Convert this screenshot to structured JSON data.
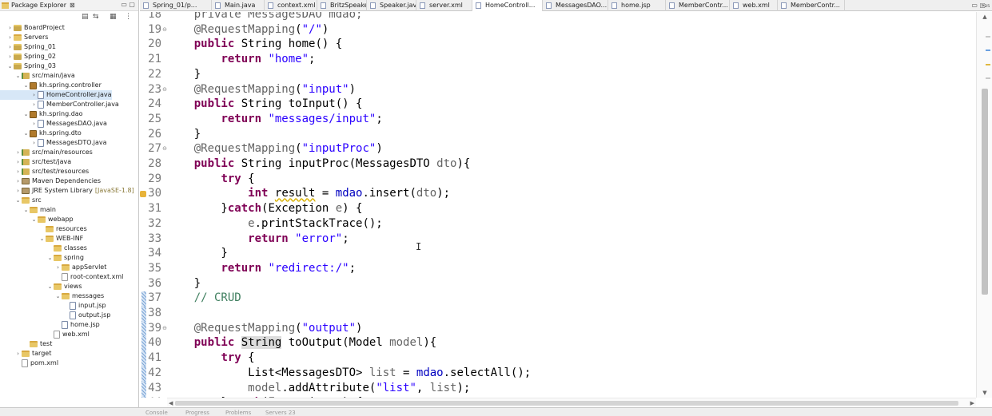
{
  "explorer": {
    "title": "Package Explorer",
    "close": "⊠",
    "winbtns": "▭  ▢",
    "tree": [
      {
        "label": "BoardProject",
        "indent": 0,
        "tw": "›",
        "icon": "proj"
      },
      {
        "label": "Servers",
        "indent": 0,
        "tw": "›",
        "icon": "folder"
      },
      {
        "label": "Spring_01",
        "indent": 0,
        "tw": "›",
        "icon": "proj"
      },
      {
        "label": "Spring_02",
        "indent": 0,
        "tw": "›",
        "icon": "proj"
      },
      {
        "label": "Spring_03",
        "indent": 0,
        "tw": "⌄",
        "icon": "proj"
      },
      {
        "label": "src/main/java",
        "indent": 1,
        "tw": "⌄",
        "icon": "srcf"
      },
      {
        "label": "kh.spring.controller",
        "indent": 2,
        "tw": "⌄",
        "icon": "pkg"
      },
      {
        "label": "HomeController.java",
        "indent": 3,
        "tw": "›",
        "icon": "java",
        "selected": true
      },
      {
        "label": "MemberController.java",
        "indent": 3,
        "tw": "›",
        "icon": "java"
      },
      {
        "label": "kh.spring.dao",
        "indent": 2,
        "tw": "⌄",
        "icon": "pkg"
      },
      {
        "label": "MessagesDAO.java",
        "indent": 3,
        "tw": "›",
        "icon": "java"
      },
      {
        "label": "kh.spring.dto",
        "indent": 2,
        "tw": "⌄",
        "icon": "pkg"
      },
      {
        "label": "MessagesDTO.java",
        "indent": 3,
        "tw": "›",
        "icon": "java"
      },
      {
        "label": "src/main/resources",
        "indent": 1,
        "tw": "›",
        "icon": "srcf"
      },
      {
        "label": "src/test/java",
        "indent": 1,
        "tw": "›",
        "icon": "srcf"
      },
      {
        "label": "src/test/resources",
        "indent": 1,
        "tw": "›",
        "icon": "srcf"
      },
      {
        "label": "Maven Dependencies",
        "indent": 1,
        "tw": "›",
        "icon": "lib"
      },
      {
        "label": "JRE System Library",
        "indent": 1,
        "tw": "›",
        "icon": "lib",
        "deco": "[JavaSE-1.8]"
      },
      {
        "label": "src",
        "indent": 1,
        "tw": "⌄",
        "icon": "folder"
      },
      {
        "label": "main",
        "indent": 2,
        "tw": "⌄",
        "icon": "folder"
      },
      {
        "label": "webapp",
        "indent": 3,
        "tw": "⌄",
        "icon": "folder"
      },
      {
        "label": "resources",
        "indent": 4,
        "tw": "",
        "icon": "folder"
      },
      {
        "label": "WEB-INF",
        "indent": 4,
        "tw": "⌄",
        "icon": "folder"
      },
      {
        "label": "classes",
        "indent": 5,
        "tw": "",
        "icon": "folder"
      },
      {
        "label": "spring",
        "indent": 5,
        "tw": "⌄",
        "icon": "folder"
      },
      {
        "label": "appServlet",
        "indent": 6,
        "tw": "›",
        "icon": "folder"
      },
      {
        "label": "root-context.xml",
        "indent": 6,
        "tw": "",
        "icon": "xml"
      },
      {
        "label": "views",
        "indent": 5,
        "tw": "⌄",
        "icon": "folder"
      },
      {
        "label": "messages",
        "indent": 6,
        "tw": "⌄",
        "icon": "folder"
      },
      {
        "label": "input.jsp",
        "indent": 7,
        "tw": "",
        "icon": "jsp"
      },
      {
        "label": "output.jsp",
        "indent": 7,
        "tw": "",
        "icon": "jsp"
      },
      {
        "label": "home.jsp",
        "indent": 6,
        "tw": "",
        "icon": "jsp"
      },
      {
        "label": "web.xml",
        "indent": 5,
        "tw": "",
        "icon": "xml"
      },
      {
        "label": "test",
        "indent": 2,
        "tw": "",
        "icon": "folder"
      },
      {
        "label": "target",
        "indent": 1,
        "tw": "›",
        "icon": "folder"
      },
      {
        "label": "pom.xml",
        "indent": 1,
        "tw": "",
        "icon": "xml"
      }
    ]
  },
  "tabs": [
    {
      "label": "Spring_01/p...",
      "width": 90
    },
    {
      "label": "Main.java",
      "width": 66
    },
    {
      "label": "context.xml",
      "width": 66
    },
    {
      "label": "BritzSpeake...",
      "width": 62
    },
    {
      "label": "Speaker.java",
      "width": 62
    },
    {
      "label": "server.xml",
      "width": 70
    },
    {
      "label": "HomeControll...",
      "width": 88,
      "active": true
    },
    {
      "label": "MessagesDAO...",
      "width": 82
    },
    {
      "label": "home.jsp",
      "width": 72
    },
    {
      "label": "MemberContr...",
      "width": 80
    },
    {
      "label": "web.xml",
      "width": 60
    },
    {
      "label": "MemberContr...",
      "width": 84
    }
  ],
  "tab_overflow": "»₂₅",
  "editor_winbtns": "▭  ▢",
  "code_lines": [
    {
      "n": "18",
      "fold": "",
      "marker": "",
      "tokens": [
        [
          "",
          "    "
        ],
        [
          "an",
          "private MessagesDAO mdao;"
        ]
      ]
    },
    {
      "n": "19",
      "fold": "⊖",
      "marker": "",
      "tokens": [
        [
          "",
          "    "
        ],
        [
          "an",
          "@RequestMapping"
        ],
        [
          "",
          "("
        ],
        [
          "st",
          "\"/\""
        ],
        [
          "",
          ")"
        ]
      ]
    },
    {
      "n": "20",
      "fold": "",
      "marker": "",
      "tokens": [
        [
          "",
          "    "
        ],
        [
          "kw",
          "public"
        ],
        [
          "",
          " String home() {"
        ]
      ]
    },
    {
      "n": "21",
      "fold": "",
      "marker": "",
      "tokens": [
        [
          "",
          "        "
        ],
        [
          "kw",
          "return"
        ],
        [
          "",
          " "
        ],
        [
          "st",
          "\"home\""
        ],
        [
          "",
          ";"
        ]
      ]
    },
    {
      "n": "22",
      "fold": "",
      "marker": "",
      "tokens": [
        [
          "",
          "    }"
        ]
      ]
    },
    {
      "n": "23",
      "fold": "⊖",
      "marker": "",
      "tokens": [
        [
          "",
          "    "
        ],
        [
          "an",
          "@RequestMapping"
        ],
        [
          "",
          "("
        ],
        [
          "st",
          "\"input\""
        ],
        [
          "",
          ")"
        ]
      ]
    },
    {
      "n": "24",
      "fold": "",
      "marker": "",
      "tokens": [
        [
          "",
          "    "
        ],
        [
          "kw",
          "public"
        ],
        [
          "",
          " String toInput() {"
        ]
      ]
    },
    {
      "n": "25",
      "fold": "",
      "marker": "",
      "tokens": [
        [
          "",
          "        "
        ],
        [
          "kw",
          "return"
        ],
        [
          "",
          " "
        ],
        [
          "st",
          "\"messages/input\""
        ],
        [
          "",
          ";"
        ]
      ]
    },
    {
      "n": "26",
      "fold": "",
      "marker": "",
      "tokens": [
        [
          "",
          "    }"
        ]
      ]
    },
    {
      "n": "27",
      "fold": "⊖",
      "marker": "",
      "tokens": [
        [
          "",
          "    "
        ],
        [
          "an",
          "@RequestMapping"
        ],
        [
          "",
          "("
        ],
        [
          "st",
          "\"inputProc\""
        ],
        [
          "",
          ")"
        ]
      ]
    },
    {
      "n": "28",
      "fold": "",
      "marker": "",
      "tokens": [
        [
          "",
          "    "
        ],
        [
          "kw",
          "public"
        ],
        [
          "",
          " String inputProc(MessagesDTO "
        ],
        [
          "an",
          "dto"
        ],
        [
          "",
          "){"
        ]
      ]
    },
    {
      "n": "29",
      "fold": "",
      "marker": "",
      "tokens": [
        [
          "",
          "        "
        ],
        [
          "kw",
          "try"
        ],
        [
          "",
          " {"
        ]
      ]
    },
    {
      "n": "30",
      "fold": "",
      "marker": "warn",
      "tokens": [
        [
          "",
          "            "
        ],
        [
          "kw",
          "int"
        ],
        [
          "",
          " "
        ],
        [
          "warn-under",
          "result"
        ],
        [
          "",
          " = "
        ],
        [
          "fld",
          "mdao"
        ],
        [
          "",
          ".insert("
        ],
        [
          "an",
          "dto"
        ],
        [
          "",
          ");"
        ]
      ]
    },
    {
      "n": "31",
      "fold": "",
      "marker": "",
      "tokens": [
        [
          "",
          "        }"
        ],
        [
          "kw",
          "catch"
        ],
        [
          "",
          "(Exception "
        ],
        [
          "an",
          "e"
        ],
        [
          "",
          ") {"
        ]
      ]
    },
    {
      "n": "32",
      "fold": "",
      "marker": "",
      "tokens": [
        [
          "",
          "            "
        ],
        [
          "an",
          "e"
        ],
        [
          "",
          ".printStackTrace();"
        ]
      ]
    },
    {
      "n": "33",
      "fold": "",
      "marker": "",
      "tokens": [
        [
          "",
          "            "
        ],
        [
          "kw",
          "return"
        ],
        [
          "",
          " "
        ],
        [
          "st",
          "\"error\""
        ],
        [
          "",
          ";"
        ]
      ]
    },
    {
      "n": "34",
      "fold": "",
      "marker": "",
      "tokens": [
        [
          "",
          "        }"
        ]
      ]
    },
    {
      "n": "35",
      "fold": "",
      "marker": "",
      "tokens": [
        [
          "",
          "        "
        ],
        [
          "kw",
          "return"
        ],
        [
          "",
          " "
        ],
        [
          "st",
          "\"redirect:/\""
        ],
        [
          "",
          ";"
        ]
      ]
    },
    {
      "n": "36",
      "fold": "",
      "marker": "",
      "tokens": [
        [
          "",
          "    }"
        ]
      ]
    },
    {
      "n": "37",
      "fold": "",
      "marker": "change",
      "tokens": [
        [
          "",
          "    "
        ],
        [
          "cm",
          "// CRUD"
        ]
      ]
    },
    {
      "n": "38",
      "fold": "",
      "marker": "change",
      "tokens": [
        [
          "",
          ""
        ]
      ]
    },
    {
      "n": "39",
      "fold": "⊖",
      "marker": "change",
      "tokens": [
        [
          "",
          "    "
        ],
        [
          "an",
          "@RequestMapping"
        ],
        [
          "",
          "("
        ],
        [
          "st",
          "\"output\""
        ],
        [
          "",
          ")"
        ]
      ]
    },
    {
      "n": "40",
      "fold": "",
      "marker": "change",
      "tokens": [
        [
          "",
          "    "
        ],
        [
          "kw",
          "public"
        ],
        [
          "",
          " "
        ],
        [
          "hl",
          "String"
        ],
        [
          "",
          " toOutput(Model "
        ],
        [
          "an",
          "model"
        ],
        [
          "",
          "){"
        ]
      ]
    },
    {
      "n": "41",
      "fold": "",
      "marker": "change",
      "tokens": [
        [
          "",
          "        "
        ],
        [
          "kw",
          "try"
        ],
        [
          "",
          " {"
        ]
      ]
    },
    {
      "n": "42",
      "fold": "",
      "marker": "change",
      "tokens": [
        [
          "",
          "            List<MessagesDTO> "
        ],
        [
          "an",
          "list"
        ],
        [
          "",
          " = "
        ],
        [
          "fld",
          "mdao"
        ],
        [
          "",
          ".selectAll();"
        ]
      ]
    },
    {
      "n": "43",
      "fold": "",
      "marker": "change",
      "tokens": [
        [
          "",
          "            "
        ],
        [
          "an",
          "model"
        ],
        [
          "",
          ".addAttribute("
        ],
        [
          "st",
          "\"list\""
        ],
        [
          "",
          ", "
        ],
        [
          "an",
          "list"
        ],
        [
          "",
          ");"
        ]
      ]
    },
    {
      "n": "44",
      "fold": "",
      "marker": "change",
      "tokens": [
        [
          "",
          "        }"
        ],
        [
          "kw",
          "catch"
        ],
        [
          "",
          "(Exception "
        ],
        [
          "an",
          "e"
        ],
        [
          "",
          ") {"
        ]
      ]
    }
  ],
  "scroll_arrows": {
    "up": "▲",
    "down": "▼",
    "left": "◀",
    "right": "▶"
  },
  "bottom_tabs": [
    "Console",
    "Progress",
    "Problems",
    "Servers 23"
  ]
}
